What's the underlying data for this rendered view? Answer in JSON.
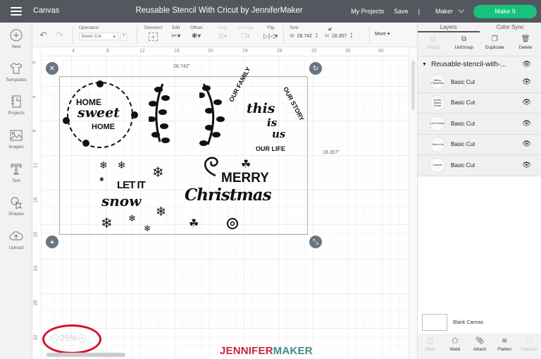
{
  "topbar": {
    "app_title": "Canvas",
    "doc_title": "Reusable Stencil With Cricut by JenniferMaker",
    "my_projects": "My Projects",
    "save": "Save",
    "separator": "|",
    "machine": "Maker",
    "make_it": "Make It",
    "make_it_color": "#17c37c"
  },
  "toolbar": {
    "operation_label": "Operation",
    "operation_value": "Basic Cut",
    "help": "?",
    "deselect_label": "Deselect",
    "edit_label": "Edit",
    "offset_label": "Offset",
    "align_label": "Align",
    "arrange_label": "Arrange",
    "flip_label": "Flip",
    "size_label": "Size",
    "width_label": "W",
    "width_value": "28.742",
    "height_label": "H",
    "height_value": "18.357",
    "more_label": "More ▾"
  },
  "sidebar": {
    "items": [
      {
        "label": "New",
        "icon": "plus-circle-icon"
      },
      {
        "label": "Templates",
        "icon": "tshirt-icon"
      },
      {
        "label": "Projects",
        "icon": "notebook-icon"
      },
      {
        "label": "Images",
        "icon": "image-icon"
      },
      {
        "label": "Text",
        "icon": "text-icon"
      },
      {
        "label": "Shapes",
        "icon": "shapes-icon"
      },
      {
        "label": "Upload",
        "icon": "cloud-upload-icon"
      }
    ]
  },
  "canvas": {
    "ruler_top": [
      "4",
      "8",
      "12",
      "16",
      "20",
      "24",
      "28",
      "32",
      "36",
      "40"
    ],
    "ruler_left": [
      "0",
      "4",
      "8",
      "12",
      "16",
      "20",
      "24",
      "28",
      "32"
    ],
    "selection_width": "28.742\"",
    "selection_height": "18.357\"",
    "zoom_level": "25%",
    "zoom_minus": "−",
    "zoom_plus": "+",
    "designs": {
      "home_1": "HOME",
      "home_sweet": "sweet",
      "home_2": "HOME",
      "our_family": "OUR FAMILY",
      "our_story": "OUR STORY",
      "this": "this",
      "is": "is",
      "us": "us",
      "our_life": "OUR LIFE",
      "let_it": "LET IT",
      "snow": "snow",
      "merry": "MERRY",
      "christmas": "Christmas"
    }
  },
  "brand": {
    "part1": "JENNIFER",
    "part2": "MAKER"
  },
  "panel": {
    "tabs": [
      "Layers",
      "Color Sync"
    ],
    "actions": [
      {
        "label": "Group",
        "icon": "group-icon",
        "enabled": false
      },
      {
        "label": "UnGroup",
        "icon": "ungroup-icon",
        "enabled": true
      },
      {
        "label": "Duplicate",
        "icon": "duplicate-icon",
        "enabled": true
      },
      {
        "label": "Delete",
        "icon": "trash-icon",
        "enabled": true
      }
    ],
    "group_name": "Reusable-stencil-with-...",
    "layers": [
      {
        "label": "Basic Cut",
        "thumb": "Merry Christmas"
      },
      {
        "label": "Basic Cut",
        "thumb": "Home Sweet Home"
      },
      {
        "label": "Basic Cut",
        "thumb": "Let it Snow"
      },
      {
        "label": "Basic Cut",
        "thumb": "This is Us"
      },
      {
        "label": "Basic Cut",
        "thumb": "Laurels"
      }
    ],
    "blank_canvas": "Blank Canvas",
    "bottom_actions": [
      {
        "label": "Slice",
        "icon": "slice-icon",
        "enabled": false
      },
      {
        "label": "Weld",
        "icon": "weld-icon",
        "enabled": true
      },
      {
        "label": "Attach",
        "icon": "paperclip-icon",
        "enabled": true
      },
      {
        "label": "Flatten",
        "icon": "flatten-icon",
        "enabled": true
      },
      {
        "label": "Contour",
        "icon": "contour-icon",
        "enabled": false
      }
    ]
  }
}
